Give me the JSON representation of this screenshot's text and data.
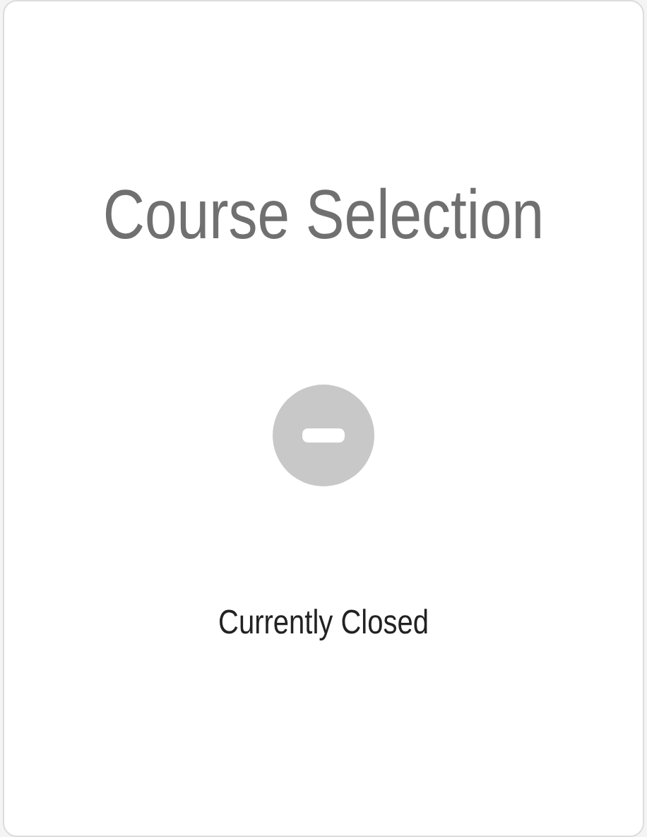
{
  "title": "Course Selection",
  "status": {
    "kind": "closed",
    "label": "Currently Closed"
  }
}
